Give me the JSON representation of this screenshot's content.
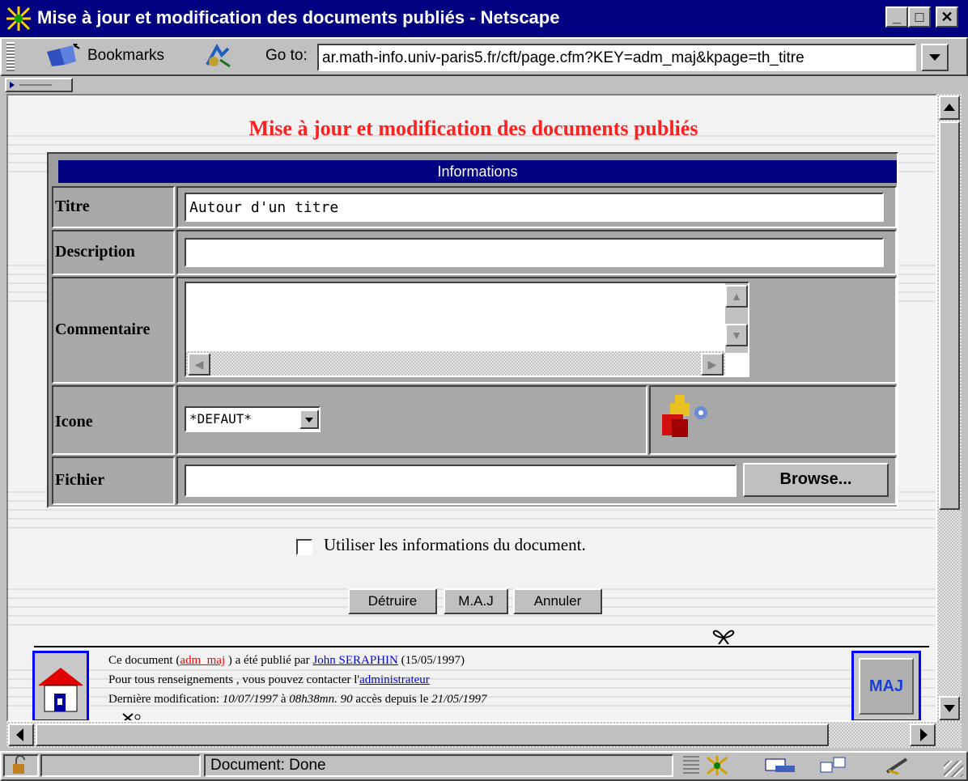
{
  "window": {
    "title": "Mise à jour et modification des documents publiés - Netscape",
    "minimize": "_",
    "maximize": "□",
    "close": "✕"
  },
  "toolbar": {
    "bookmarks_label": "Bookmarks",
    "goto_label": "Go to:",
    "url": "ar.math-info.univ-paris5.fr/cft/page.cfm?KEY=adm_maj&kpage=th_titre"
  },
  "page": {
    "title": "Mise à jour et modification des documents publiés",
    "section_header": "Informations",
    "fields": {
      "titre_label": "Titre",
      "titre_value": "Autour d'un titre",
      "description_label": "Description",
      "description_value": "",
      "commentaire_label": "Commentaire",
      "commentaire_value": "",
      "icone_label": "Icone",
      "icone_selected": "*DEFAUT*",
      "fichier_label": "Fichier",
      "fichier_value": "",
      "browse_label": "Browse..."
    },
    "use_info_label": "Utiliser les informations du document.",
    "buttons": {
      "detruire": "Détruire",
      "maj": "M.A.J",
      "annuler": "Annuler"
    }
  },
  "footer": {
    "line1_prefix": "Ce document (",
    "doc_key": "adm_maj",
    "line1_mid": " ) a été publié par ",
    "author": "John SERAPHIN",
    "line1_suffix": " (15/05/1997)",
    "line2_prefix": "Pour tous renseignements , vous pouvez contacter l'",
    "admin_link": "administrateur",
    "line3_prefix": "Dernière modification: ",
    "modified_date": "10/07/1997",
    "line3_a": " à ",
    "modified_time": "08h38mn. 90",
    "line3_b": " accès depuis le ",
    "since_date": "21/05/1997",
    "maj_badge": "MAJ"
  },
  "status": {
    "text": "Document: Done"
  }
}
